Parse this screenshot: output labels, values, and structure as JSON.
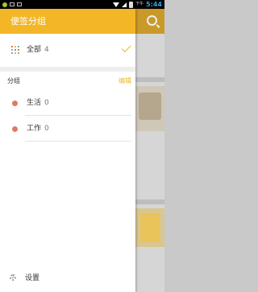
{
  "status_bar": {
    "ampm": "下午",
    "time": "5:44"
  },
  "drawer": {
    "title": "便签分组",
    "all": {
      "label": "全部",
      "count": "4"
    },
    "groups_header": {
      "title": "分组",
      "edit_label": "编辑"
    },
    "groups": [
      {
        "label": "生活",
        "count": "0",
        "color": "#e07a5f"
      },
      {
        "label": "工作",
        "count": "0",
        "color": "#e07a5f"
      }
    ],
    "settings_label": "设置"
  },
  "colors": {
    "accent": "#f2b627",
    "icon_dots": [
      "#e27b66",
      "#f2b627",
      "#6cb0d6",
      "#8cc06a",
      "#9b7fc2",
      "#e27b66",
      "#6cb0d6",
      "#f2b627",
      "#8cc06a"
    ]
  }
}
